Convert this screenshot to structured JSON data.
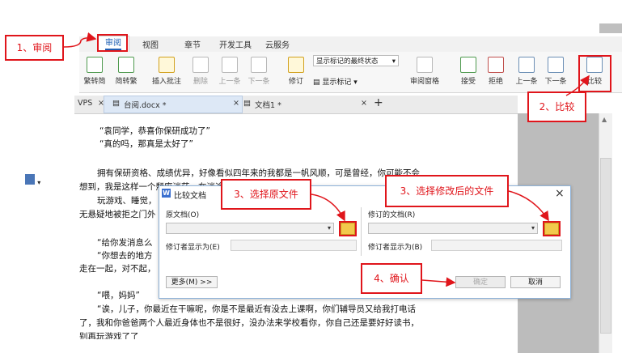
{
  "ribbon": {
    "tabs": [
      "审阅",
      "视图",
      "章节",
      "开发工具",
      "云服务"
    ],
    "active_tab": "审阅",
    "buttons": {
      "trad_to_simp": "繁转简",
      "simp_to_trad": "简转繁",
      "insert_comment": "插入批注",
      "delete": "删除",
      "prev_comment": "上一条",
      "next_comment": "下一条",
      "track_changes": "修订",
      "mode_select": "显示标记的最终状态",
      "show_markup": "显示标记",
      "review_pane": "审阅窗格",
      "accept": "接受",
      "reject": "拒绝",
      "prev_change": "上一条",
      "next_change": "下一条",
      "compare": "比较"
    }
  },
  "doc_tabs": {
    "app": "VPS",
    "tabs": [
      "台阅.docx *",
      "文档1 *"
    ],
    "close": "×",
    "add": "+"
  },
  "document": {
    "lines": [
      "“袁同学，恭喜你保研成功了”",
      "“真的吗，那真是太好了”",
      "拥有保研资格、成绩优异，好像看似四年来的我都是一帆风顺，可是曾经，你可能不会",
      "想到，我是这样一个颓废迷茫、在迷途中努力的失败者。",
      "玩游戏、睡觉，",
      "无悬疑地被拒之门外",
      "“给你发消息么",
      "“你想去的地方",
      "走在一起，对不起，",
      "“喂，妈妈”",
      "“诶，儿子，你最近在干嘛呢，你是不是最近有没去上课啊，你们辅导员又给我打电话",
      "了，我和你爸爸两个人最近身体也不是很好，没办法来学校看你，你自己还是要好好读书，",
      "别再玩游戏了了"
    ]
  },
  "dialog": {
    "title": "比较文档",
    "close": "×",
    "original_label": "原文档(O)",
    "revised_label": "修订的文档(R)",
    "original_author_label": "修订者显示为(E)",
    "revised_author_label": "修订者显示为(B)",
    "more_button": "更多(M) >>",
    "ok_button": "确定",
    "cancel_button": "取消"
  },
  "annotations": {
    "step1": "1、审阅",
    "step2": "2、比较",
    "step3a": "3、选择原文件",
    "step3b": "3、选择修改后的文件",
    "step4": "4、确认"
  },
  "colors": {
    "annotation_red": "#e0151b",
    "accent_blue": "#1e5fb4",
    "dialog_border": "#8fb3d9"
  }
}
